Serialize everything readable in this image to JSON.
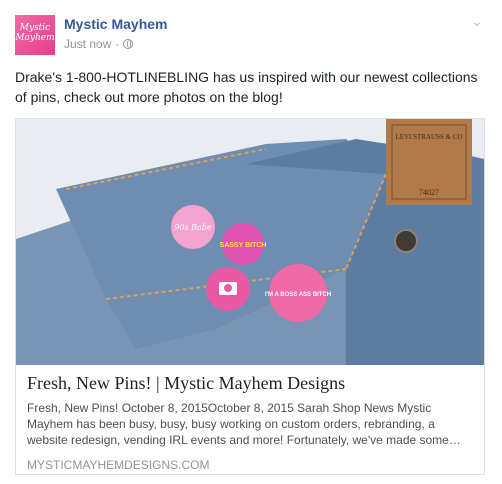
{
  "post": {
    "page_name": "Mystic Mayhem",
    "timestamp": "Just now",
    "separator": "·",
    "avatar_text": "Mystic Mayhem",
    "text": "Drake's 1-800-HOTLINEBLING has us inspired with our newest collections of pins, check out more photos on the blog!",
    "privacy_icon": "globe-icon",
    "menu_icon": "chevron-down-icon"
  },
  "link": {
    "title": "Fresh, New Pins! | Mystic Mayhem Designs",
    "description": "Fresh, New Pins! October 8, 2015October 8, 2015 Sarah Shop News Mystic Mayhem has been busy, busy, busy working on custom orders, rebranding, a website redesign, vending IRL events and more! Fortunately, we've made some…",
    "domain": "MYSTICMAYHEMDESIGNS.COM"
  },
  "image": {
    "pins": [
      {
        "text": "90s Babe"
      },
      {
        "text": "SASSY BITCH"
      },
      {
        "text": "I'M A BOSS ASS BITCH"
      },
      {
        "text": ""
      }
    ],
    "label_text": "LEVI STRAUSS & CO",
    "label_number": "74027"
  },
  "colors": {
    "brand_link": "#365899",
    "text": "#1d2129",
    "muted": "#90949c",
    "pin_pink": "#f06aa8"
  }
}
